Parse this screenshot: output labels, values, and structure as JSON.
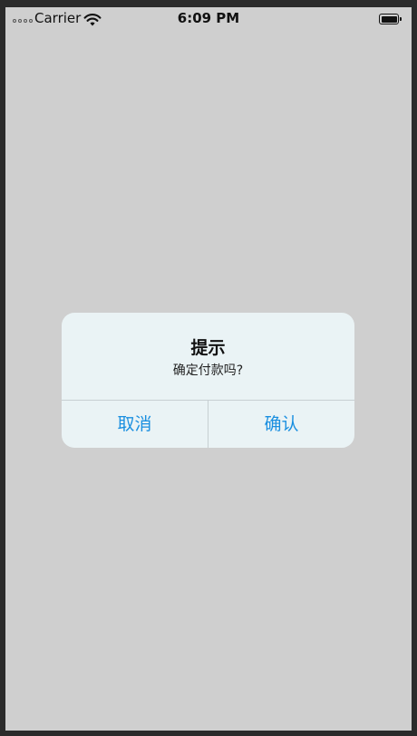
{
  "status_bar": {
    "carrier": "Carrier",
    "time": "6:09 PM",
    "icons": [
      "signal-dots-icon",
      "wifi-icon",
      "battery-icon"
    ]
  },
  "alert": {
    "title": "提示",
    "message": "确定付款吗?",
    "buttons": {
      "cancel_label": "取消",
      "confirm_label": "确认"
    }
  },
  "colors": {
    "background": "#cfcfcf",
    "alert_background": "#eaf3f5",
    "button_text": "#1a8fe0",
    "divider": "#c7cfd2"
  }
}
